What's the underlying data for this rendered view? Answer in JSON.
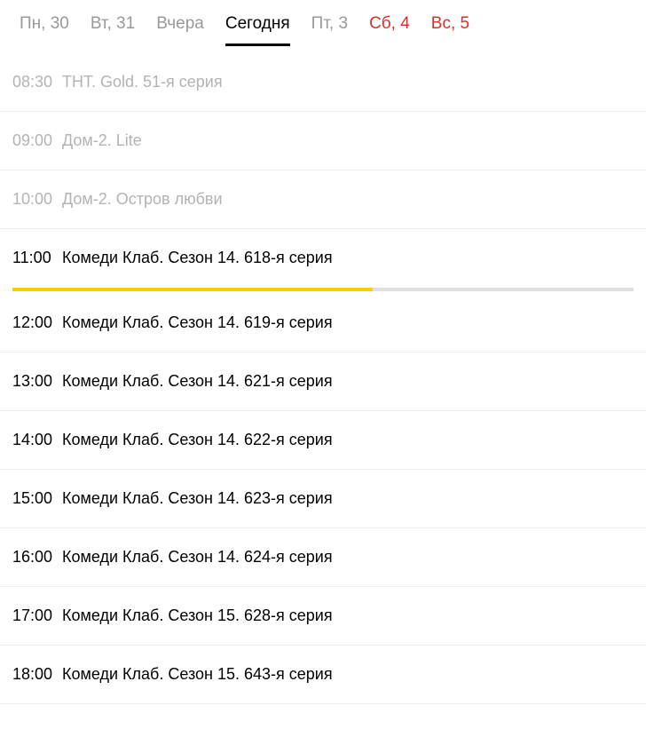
{
  "tabs": [
    {
      "label": "Пн, 30",
      "active": false,
      "weekend": false
    },
    {
      "label": "Вт, 31",
      "active": false,
      "weekend": false
    },
    {
      "label": "Вчера",
      "active": false,
      "weekend": false
    },
    {
      "label": "Сегодня",
      "active": true,
      "weekend": false
    },
    {
      "label": "Пт, 3",
      "active": false,
      "weekend": false
    },
    {
      "label": "Сб, 4",
      "active": false,
      "weekend": true
    },
    {
      "label": "Вс, 5",
      "active": false,
      "weekend": true
    }
  ],
  "programs": [
    {
      "time": "08:30",
      "title": "ТНТ. Gold. 51-я серия",
      "past": true,
      "current": false,
      "progress": 0
    },
    {
      "time": "09:00",
      "title": "Дом-2. Lite",
      "past": true,
      "current": false,
      "progress": 0
    },
    {
      "time": "10:00",
      "title": "Дом-2. Остров любви",
      "past": true,
      "current": false,
      "progress": 0
    },
    {
      "time": "11:00",
      "title": "Комеди Клаб. Сезон 14. 618-я серия",
      "past": false,
      "current": true,
      "progress": 58
    },
    {
      "time": "12:00",
      "title": "Комеди Клаб. Сезон 14. 619-я серия",
      "past": false,
      "current": false,
      "progress": 0
    },
    {
      "time": "13:00",
      "title": "Комеди Клаб. Сезон 14. 621-я серия",
      "past": false,
      "current": false,
      "progress": 0
    },
    {
      "time": "14:00",
      "title": "Комеди Клаб. Сезон 14. 622-я серия",
      "past": false,
      "current": false,
      "progress": 0
    },
    {
      "time": "15:00",
      "title": "Комеди Клаб. Сезон 14. 623-я серия",
      "past": false,
      "current": false,
      "progress": 0
    },
    {
      "time": "16:00",
      "title": "Комеди Клаб. Сезон 14. 624-я серия",
      "past": false,
      "current": false,
      "progress": 0
    },
    {
      "time": "17:00",
      "title": "Комеди Клаб. Сезон 15. 628-я серия",
      "past": false,
      "current": false,
      "progress": 0
    },
    {
      "time": "18:00",
      "title": "Комеди Клаб. Сезон 15. 643-я серия",
      "past": false,
      "current": false,
      "progress": 0
    }
  ]
}
